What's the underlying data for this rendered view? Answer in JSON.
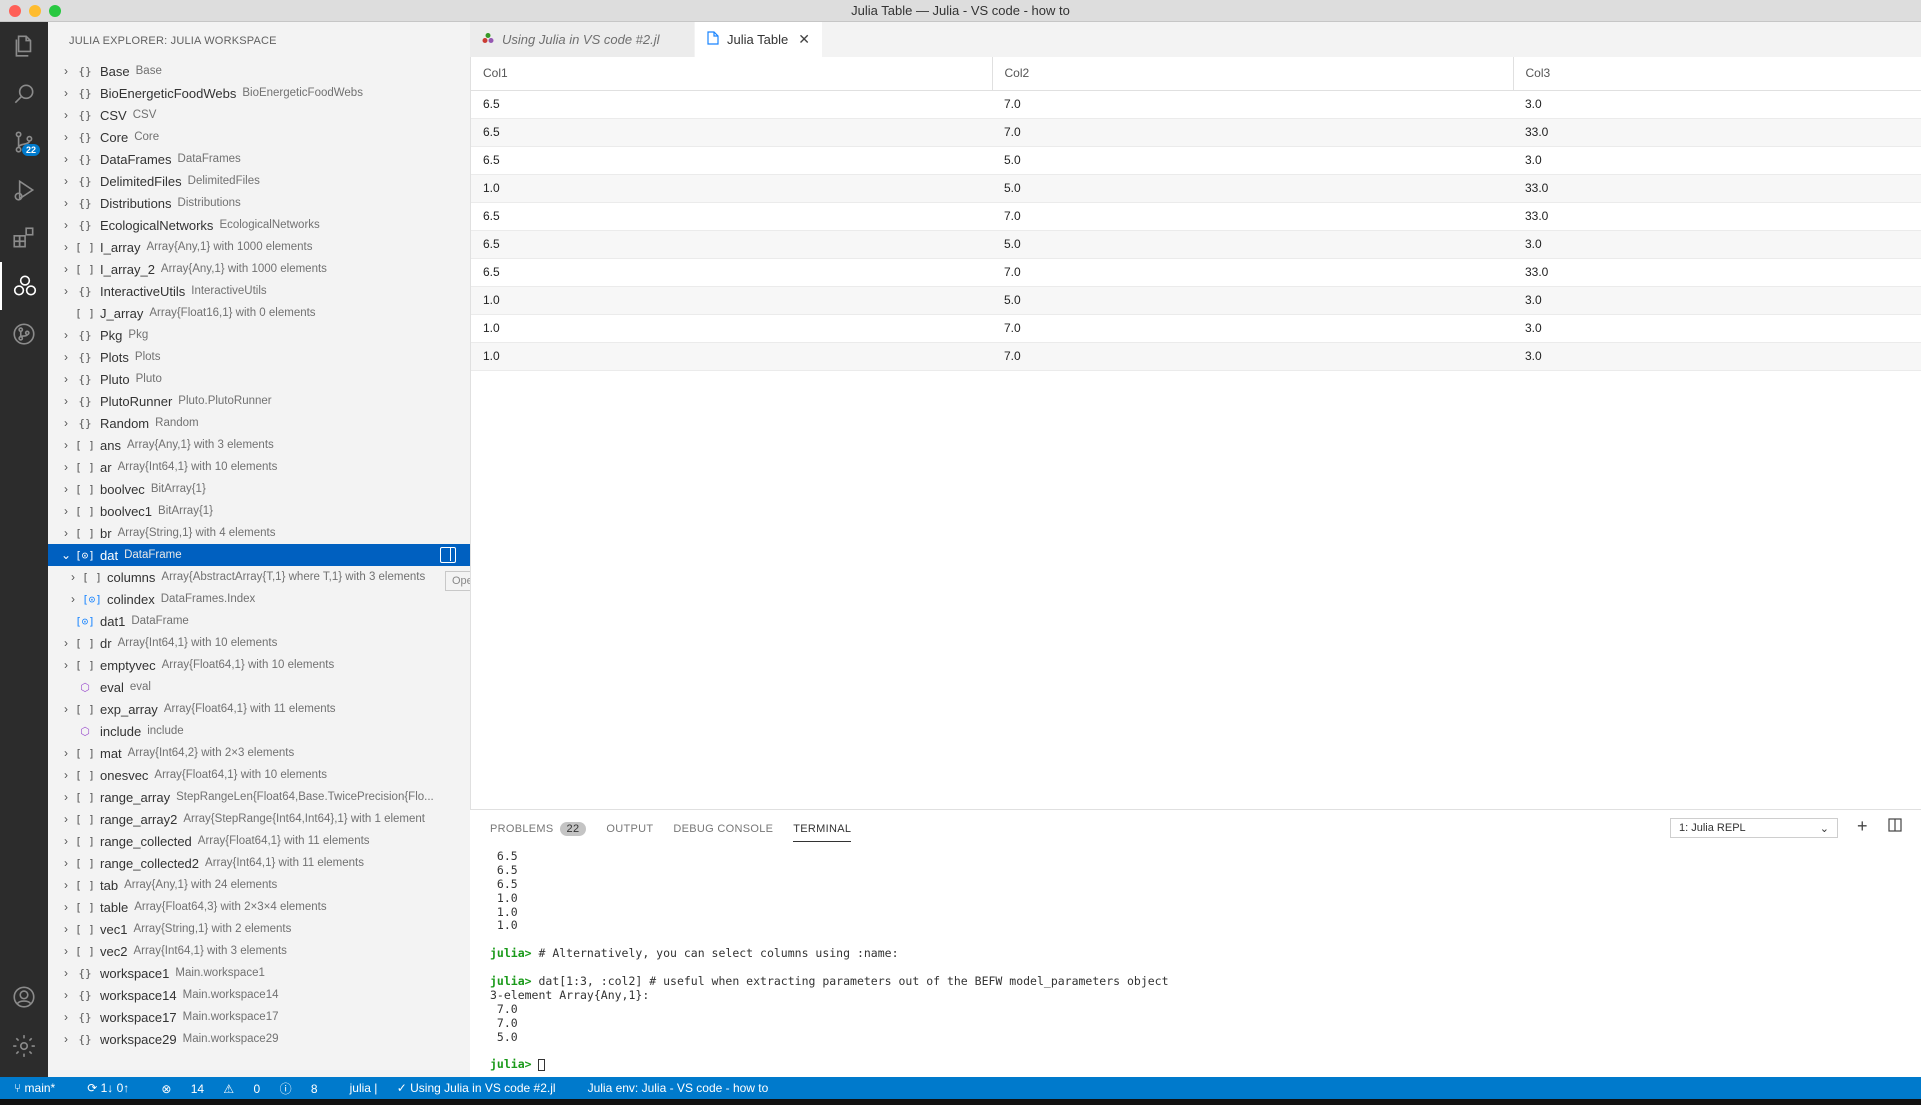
{
  "window": {
    "title": "Julia Table — Julia - VS code - how to"
  },
  "activity": {
    "scm_badge": "22"
  },
  "sidebar": {
    "header": "JULIA EXPLORER: JULIA WORKSPACE",
    "items": [
      {
        "chev": "›",
        "kind": "{}",
        "name": "Base",
        "desc": "Base"
      },
      {
        "chev": "›",
        "kind": "{}",
        "name": "BioEnergeticFoodWebs",
        "desc": "BioEnergeticFoodWebs"
      },
      {
        "chev": "›",
        "kind": "{}",
        "name": "CSV",
        "desc": "CSV"
      },
      {
        "chev": "›",
        "kind": "{}",
        "name": "Core",
        "desc": "Core"
      },
      {
        "chev": "›",
        "kind": "{}",
        "name": "DataFrames",
        "desc": "DataFrames"
      },
      {
        "chev": "›",
        "kind": "{}",
        "name": "DelimitedFiles",
        "desc": "DelimitedFiles"
      },
      {
        "chev": "›",
        "kind": "{}",
        "name": "Distributions",
        "desc": "Distributions"
      },
      {
        "chev": "›",
        "kind": "{}",
        "name": "EcologicalNetworks",
        "desc": "EcologicalNetworks"
      },
      {
        "chev": "›",
        "kind": "[ ]",
        "name": "I_array",
        "desc": "Array{Any,1} with 1000 elements"
      },
      {
        "chev": "›",
        "kind": "[ ]",
        "name": "I_array_2",
        "desc": "Array{Any,1} with 1000 elements"
      },
      {
        "chev": "›",
        "kind": "{}",
        "name": "InteractiveUtils",
        "desc": "InteractiveUtils"
      },
      {
        "chev": "",
        "kind": "[ ]",
        "name": "J_array",
        "desc": "Array{Float16,1} with 0 elements"
      },
      {
        "chev": "›",
        "kind": "{}",
        "name": "Pkg",
        "desc": "Pkg"
      },
      {
        "chev": "›",
        "kind": "{}",
        "name": "Plots",
        "desc": "Plots"
      },
      {
        "chev": "›",
        "kind": "{}",
        "name": "Pluto",
        "desc": "Pluto"
      },
      {
        "chev": "›",
        "kind": "{}",
        "name": "PlutoRunner",
        "desc": "Pluto.PlutoRunner"
      },
      {
        "chev": "›",
        "kind": "{}",
        "name": "Random",
        "desc": "Random"
      },
      {
        "chev": "›",
        "kind": "[ ]",
        "name": "ans",
        "desc": "Array{Any,1} with 3 elements"
      },
      {
        "chev": "›",
        "kind": "[ ]",
        "name": "ar",
        "desc": "Array{Int64,1} with 10 elements"
      },
      {
        "chev": "›",
        "kind": "[ ]",
        "name": "boolvec",
        "desc": "BitArray{1}"
      },
      {
        "chev": "›",
        "kind": "[ ]",
        "name": "boolvec1",
        "desc": "BitArray{1}"
      },
      {
        "chev": "›",
        "kind": "[ ]",
        "name": "br",
        "desc": "Array{String,1} with 4 elements"
      }
    ],
    "selected": {
      "chev": "⌄",
      "kind": "[⊙]",
      "name": "dat",
      "desc": "DataFrame",
      "tooltip": "Open in VS Code"
    },
    "children": [
      {
        "chev": "›",
        "kind": "[ ]",
        "name": "columns",
        "desc": "Array{AbstractArray{T,1} where T,1} with 3 elements"
      },
      {
        "chev": "›",
        "kind": "[⊙]",
        "name": "colindex",
        "desc": "DataFrames.Index"
      }
    ],
    "items_after": [
      {
        "chev": "",
        "kind": "[⊙]",
        "name": "dat1",
        "desc": "DataFrame"
      },
      {
        "chev": "›",
        "kind": "[ ]",
        "name": "dr",
        "desc": "Array{Int64,1} with 10 elements"
      },
      {
        "chev": "›",
        "kind": "[ ]",
        "name": "emptyvec",
        "desc": "Array{Float64,1} with 10 elements"
      },
      {
        "chev": "",
        "kind": "⬡",
        "name": "eval",
        "desc": "eval"
      },
      {
        "chev": "›",
        "kind": "[ ]",
        "name": "exp_array",
        "desc": "Array{Float64,1} with 11 elements"
      },
      {
        "chev": "",
        "kind": "⬡",
        "name": "include",
        "desc": "include"
      },
      {
        "chev": "›",
        "kind": "[ ]",
        "name": "mat",
        "desc": "Array{Int64,2} with 2×3 elements"
      },
      {
        "chev": "›",
        "kind": "[ ]",
        "name": "onesvec",
        "desc": "Array{Float64,1} with 10 elements"
      },
      {
        "chev": "›",
        "kind": "[ ]",
        "name": "range_array",
        "desc": "StepRangeLen{Float64,Base.TwicePrecision{Flo..."
      },
      {
        "chev": "›",
        "kind": "[ ]",
        "name": "range_array2",
        "desc": "Array{StepRange{Int64,Int64},1} with 1 element"
      },
      {
        "chev": "›",
        "kind": "[ ]",
        "name": "range_collected",
        "desc": "Array{Float64,1} with 11 elements"
      },
      {
        "chev": "›",
        "kind": "[ ]",
        "name": "range_collected2",
        "desc": "Array{Int64,1} with 11 elements"
      },
      {
        "chev": "›",
        "kind": "[ ]",
        "name": "tab",
        "desc": "Array{Any,1} with 24 elements"
      },
      {
        "chev": "›",
        "kind": "[ ]",
        "name": "table",
        "desc": "Array{Float64,3} with 2×3×4 elements"
      },
      {
        "chev": "›",
        "kind": "[ ]",
        "name": "vec1",
        "desc": "Array{String,1} with 2 elements"
      },
      {
        "chev": "›",
        "kind": "[ ]",
        "name": "vec2",
        "desc": "Array{Int64,1} with 3 elements"
      },
      {
        "chev": "›",
        "kind": "{}",
        "name": "workspace1",
        "desc": "Main.workspace1"
      },
      {
        "chev": "›",
        "kind": "{}",
        "name": "workspace14",
        "desc": "Main.workspace14"
      },
      {
        "chev": "›",
        "kind": "{}",
        "name": "workspace17",
        "desc": "Main.workspace17"
      },
      {
        "chev": "›",
        "kind": "{}",
        "name": "workspace29",
        "desc": "Main.workspace29"
      }
    ]
  },
  "tabs": [
    {
      "label": "Using Julia in VS code #2.jl",
      "active": false
    },
    {
      "label": "Julia Table",
      "active": true
    }
  ],
  "table": {
    "columns": [
      "Col1",
      "Col2",
      "Col3"
    ],
    "rows": [
      [
        "6.5",
        "7.0",
        "3.0"
      ],
      [
        "6.5",
        "7.0",
        "33.0"
      ],
      [
        "6.5",
        "5.0",
        "3.0"
      ],
      [
        "1.0",
        "5.0",
        "33.0"
      ],
      [
        "6.5",
        "7.0",
        "33.0"
      ],
      [
        "6.5",
        "5.0",
        "3.0"
      ],
      [
        "6.5",
        "7.0",
        "33.0"
      ],
      [
        "1.0",
        "5.0",
        "3.0"
      ],
      [
        "1.0",
        "7.0",
        "3.0"
      ],
      [
        "1.0",
        "7.0",
        "3.0"
      ]
    ]
  },
  "panel": {
    "tabs": [
      "PROBLEMS",
      "OUTPUT",
      "DEBUG CONSOLE",
      "TERMINAL"
    ],
    "problems_count": "22",
    "terminal_select": "1: Julia REPL",
    "terminal_lines": [
      " 6.5",
      " 6.5",
      " 6.5",
      " 1.0",
      " 1.0",
      " 1.0",
      "",
      "julia> # Alternatively, you can select columns using :name:",
      "",
      "julia> dat[1:3, :col2] # useful when extracting parameters out of the BEFW model_parameters object",
      "3-element Array{Any,1}:",
      " 7.0",
      " 7.0",
      " 5.0",
      "",
      "julia> "
    ]
  },
  "status": {
    "branch": "main*",
    "sync": "1↓ 0↑",
    "errors": "14",
    "warnings": "0",
    "info": "8",
    "julia": "julia |",
    "file": "Using Julia in VS code #2.jl",
    "env": "Julia env: Julia - VS code - how to"
  },
  "colors": {
    "accent": "#007acc",
    "selection": "#0060c0",
    "activity_bg": "#2c2c2c"
  }
}
